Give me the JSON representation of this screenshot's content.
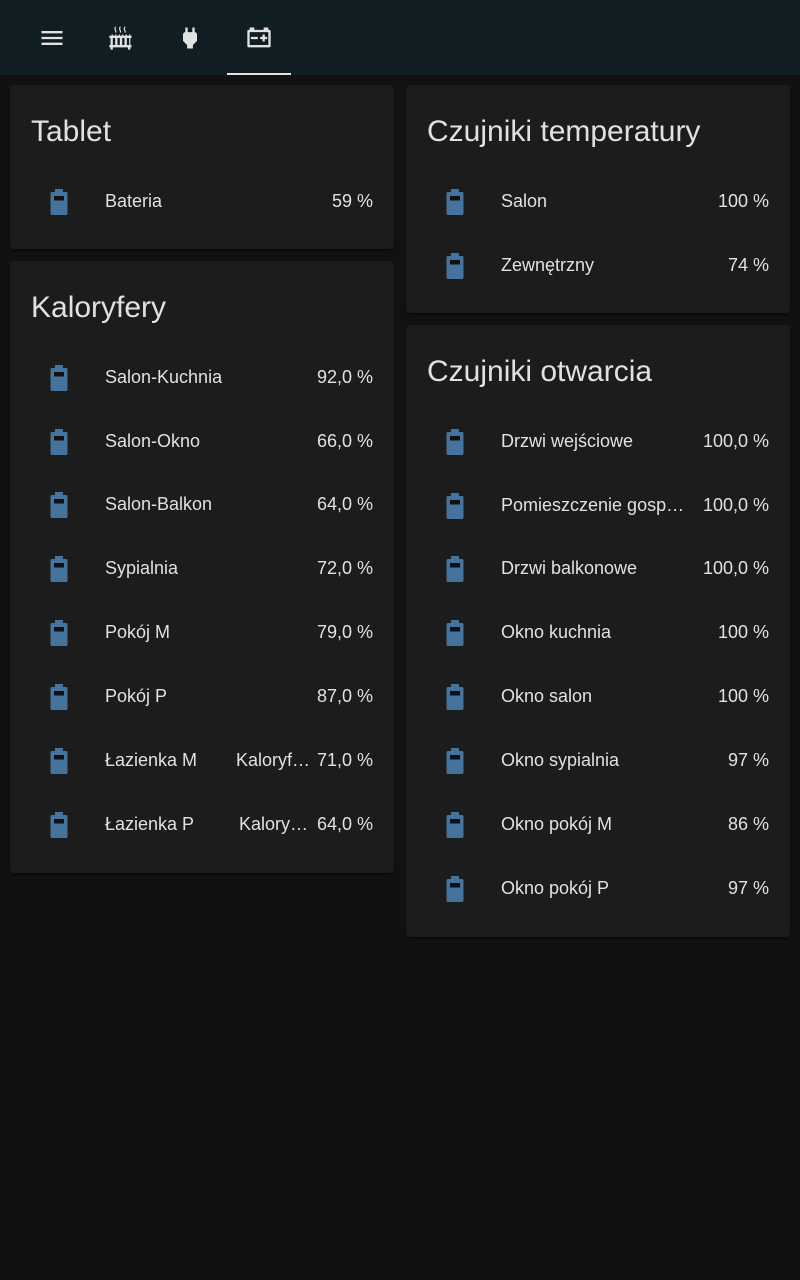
{
  "colors": {
    "header_bg": "#101e24",
    "page_bg": "#111111",
    "card_bg": "#1c1c1c",
    "battery_icon": "#44739e",
    "text": "#e1e1e1"
  },
  "tabs": [
    {
      "icon": "menu-icon"
    },
    {
      "icon": "radiator-icon"
    },
    {
      "icon": "power-plug-icon"
    },
    {
      "icon": "car-battery-icon",
      "active": true
    }
  ],
  "cards": {
    "tablet": {
      "title": "Tablet",
      "rows": [
        {
          "name": "Bateria",
          "value": "59 %"
        }
      ]
    },
    "kaloryfery": {
      "title": "Kaloryfery",
      "rows": [
        {
          "name": "Salon-Kuchnia",
          "value": "92,0 %"
        },
        {
          "name": "Salon-Okno",
          "value": "66,0 %"
        },
        {
          "name": "Salon-Balkon",
          "value": "64,0 %"
        },
        {
          "name": "Sypialnia",
          "value": "72,0 %"
        },
        {
          "name": "Pokój M",
          "value": "79,0 %"
        },
        {
          "name": "Pokój P",
          "value": "87,0 %"
        },
        {
          "name": "Łazienka M",
          "secondary": "Kaloryf…",
          "value": "71,0 %"
        },
        {
          "name": "Łazienka P",
          "secondary": "Kalory…",
          "value": "64,0 %"
        }
      ]
    },
    "czujniki_temperatury": {
      "title": "Czujniki temperatury",
      "rows": [
        {
          "name": "Salon",
          "value": "100 %"
        },
        {
          "name": "Zewnętrzny",
          "value": "74 %"
        }
      ]
    },
    "czujniki_otwarcia": {
      "title": "Czujniki otwarcia",
      "rows": [
        {
          "name": "Drzwi wejściowe",
          "value": "100,0 %"
        },
        {
          "name": "Pomieszczenie gosp…",
          "value": "100,0 %"
        },
        {
          "name": "Drzwi balkonowe",
          "value": "100,0 %"
        },
        {
          "name": "Okno kuchnia",
          "value": "100 %"
        },
        {
          "name": "Okno salon",
          "value": "100 %"
        },
        {
          "name": "Okno sypialnia",
          "value": "97 %"
        },
        {
          "name": "Okno pokój M",
          "value": "86 %"
        },
        {
          "name": "Okno pokój P",
          "value": "97 %"
        }
      ]
    }
  }
}
